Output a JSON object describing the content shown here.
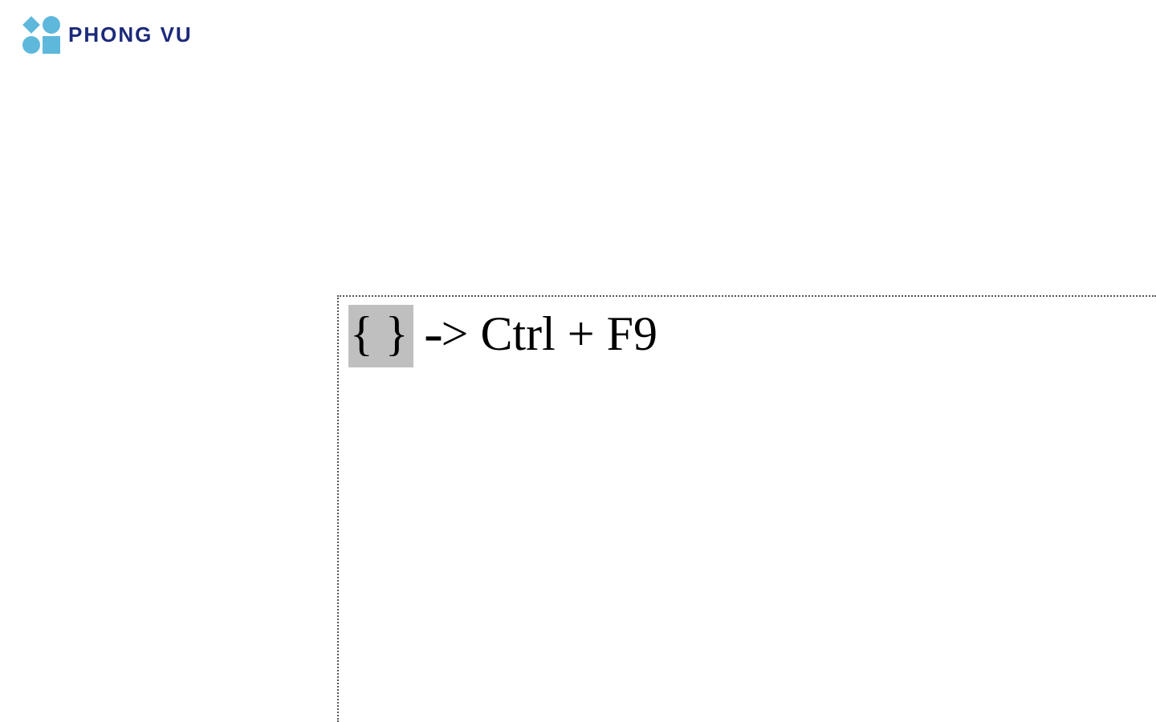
{
  "logo": {
    "brand": "PHONG VU"
  },
  "document": {
    "field_code_placeholder": "{  }",
    "arrow": "->",
    "shortcut": "Ctrl + F9"
  }
}
